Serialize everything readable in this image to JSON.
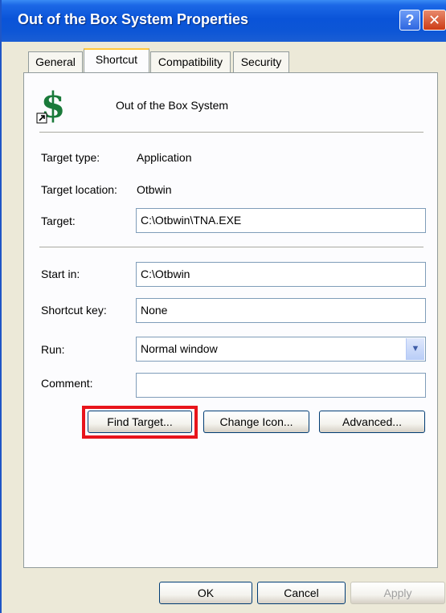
{
  "window": {
    "title": "Out of the Box System Properties",
    "help_glyph": "?",
    "close_glyph": "✕"
  },
  "tabs": [
    {
      "label": "General",
      "active": false
    },
    {
      "label": "Shortcut",
      "active": true
    },
    {
      "label": "Compatibility",
      "active": false
    },
    {
      "label": "Security",
      "active": false
    }
  ],
  "shortcut": {
    "icon": "dollar-shortcut-icon",
    "name": "Out of the Box System",
    "target_type_label": "Target type:",
    "target_type_value": "Application",
    "target_location_label": "Target location:",
    "target_location_value": "Otbwin",
    "target_label": "Target:",
    "target_value": "C:\\Otbwin\\TNA.EXE",
    "start_in_label": "Start in:",
    "start_in_value": "C:\\Otbwin",
    "shortcut_key_label": "Shortcut key:",
    "shortcut_key_value": "None",
    "run_label": "Run:",
    "run_value": "Normal window",
    "comment_label": "Comment:",
    "comment_value": ""
  },
  "buttons": {
    "find_target": "Find Target...",
    "change_icon": "Change Icon...",
    "advanced": "Advanced...",
    "ok": "OK",
    "cancel": "Cancel",
    "apply": "Apply"
  },
  "colors": {
    "title_bar": "#0a54d8",
    "highlight": "#e8141b",
    "dialog_bg": "#ece9d8"
  }
}
